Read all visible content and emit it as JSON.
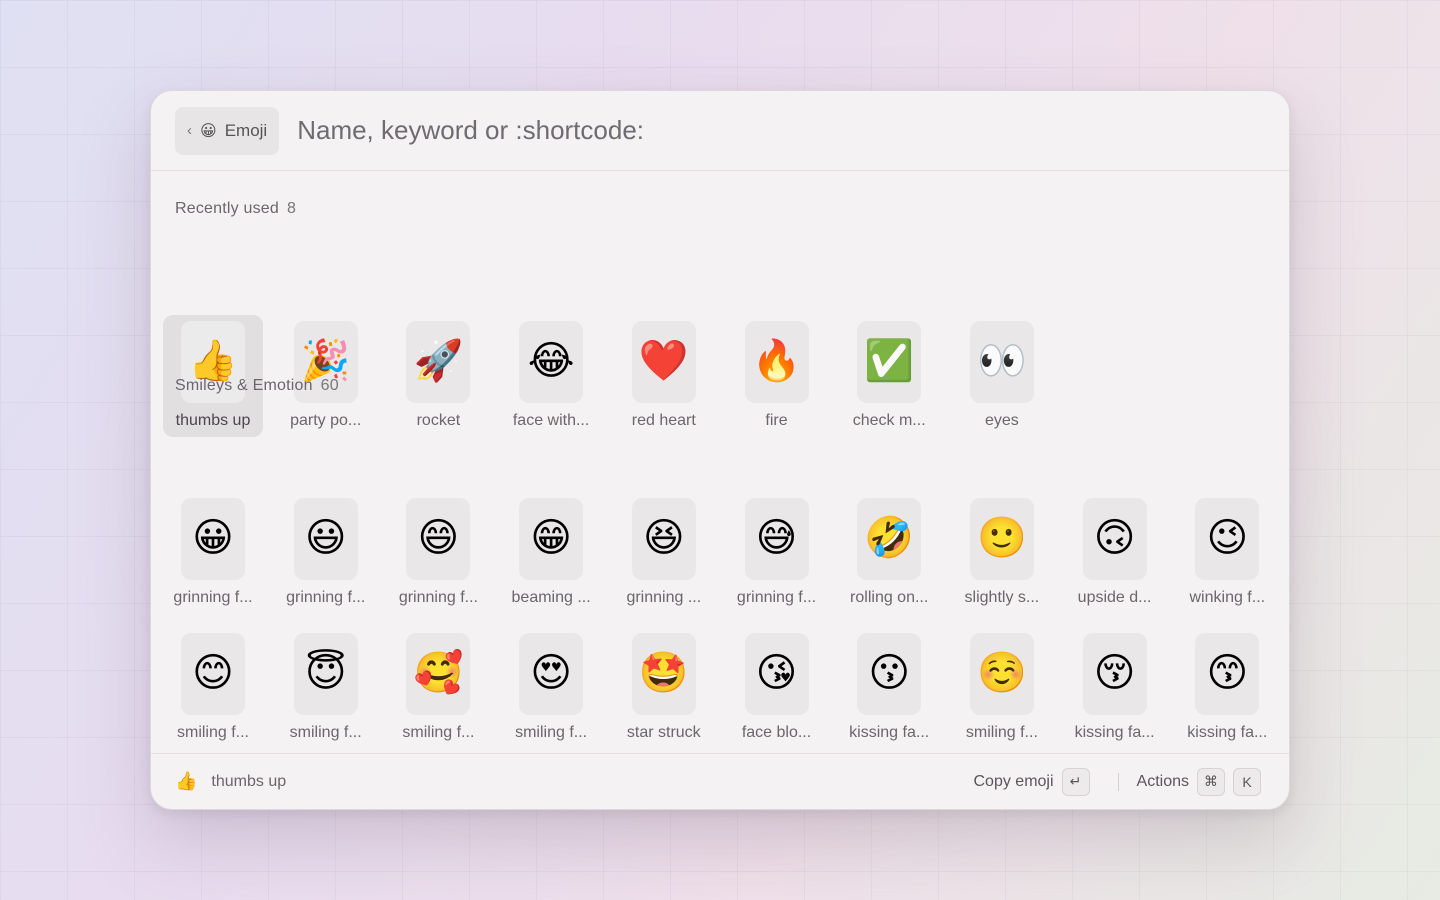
{
  "header": {
    "back_chevron": "‹",
    "chip_emoji": "😀",
    "chip_label": "Emoji",
    "search_placeholder": "Name, keyword or :shortcode:"
  },
  "sections": [
    {
      "title": "Recently used",
      "count": "8",
      "items": [
        {
          "emoji": "👍",
          "label": "thumbs up"
        },
        {
          "emoji": "🎉",
          "label": "party po..."
        },
        {
          "emoji": "🚀",
          "label": "rocket"
        },
        {
          "emoji": "😂",
          "label": "face with..."
        },
        {
          "emoji": "❤️",
          "label": "red heart"
        },
        {
          "emoji": "🔥",
          "label": "fire"
        },
        {
          "emoji": "✅",
          "label": "check m..."
        },
        {
          "emoji": "👀",
          "label": "eyes"
        }
      ]
    },
    {
      "title": "Smileys & Emotion",
      "count": "60",
      "items": [
        {
          "emoji": "😀",
          "label": "grinning f..."
        },
        {
          "emoji": "😃",
          "label": "grinning f..."
        },
        {
          "emoji": "😄",
          "label": "grinning f..."
        },
        {
          "emoji": "😁",
          "label": "beaming ..."
        },
        {
          "emoji": "😆",
          "label": "grinning ..."
        },
        {
          "emoji": "😅",
          "label": "grinning f..."
        },
        {
          "emoji": "🤣",
          "label": "rolling on..."
        },
        {
          "emoji": "🙂",
          "label": "slightly s..."
        },
        {
          "emoji": "🙃",
          "label": "upside d..."
        },
        {
          "emoji": "😉",
          "label": "winking f..."
        },
        {
          "emoji": "😊",
          "label": "smiling f..."
        },
        {
          "emoji": "😇",
          "label": "smiling f..."
        },
        {
          "emoji": "🥰",
          "label": "smiling f..."
        },
        {
          "emoji": "😍",
          "label": "smiling f..."
        },
        {
          "emoji": "🤩",
          "label": "star struck"
        },
        {
          "emoji": "😘",
          "label": "face blo..."
        },
        {
          "emoji": "😗",
          "label": "kissing fa..."
        },
        {
          "emoji": "☺️",
          "label": "smiling f..."
        },
        {
          "emoji": "😚",
          "label": "kissing fa..."
        },
        {
          "emoji": "😙",
          "label": "kissing fa..."
        },
        {
          "emoji": "😋",
          "label": ""
        },
        {
          "emoji": "😛",
          "label": ""
        },
        {
          "emoji": "😜",
          "label": ""
        },
        {
          "emoji": "🤪",
          "label": ""
        },
        {
          "emoji": "😝",
          "label": ""
        },
        {
          "emoji": "🤑",
          "label": ""
        },
        {
          "emoji": "🤗",
          "label": ""
        },
        {
          "emoji": "🤭",
          "label": ""
        },
        {
          "emoji": "🤫",
          "label": ""
        },
        {
          "emoji": "🤔",
          "label": ""
        }
      ]
    }
  ],
  "selected_index": 0,
  "footer": {
    "selected_emoji": "👍",
    "selected_label": "thumbs up",
    "primary_action": "Copy emoji",
    "primary_key": "↵",
    "actions_label": "Actions",
    "actions_key_1": "⌘",
    "actions_key_2": "K"
  }
}
